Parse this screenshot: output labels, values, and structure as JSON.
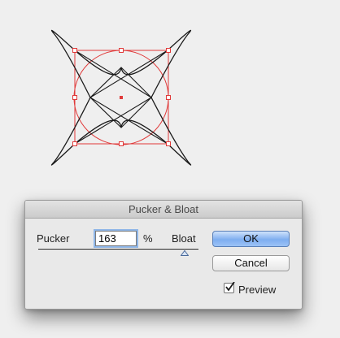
{
  "dialog": {
    "title": "Pucker & Bloat",
    "pucker_label": "Pucker",
    "amount_value": "163",
    "percent_label": "%",
    "bloat_label": "Bloat",
    "ok_label": "OK",
    "cancel_label": "Cancel",
    "preview_label": "Preview",
    "preview_checked": true
  },
  "colors": {
    "selection": "#e03a3a",
    "path": "#1a1a1a",
    "ok_button": "#7eaef0"
  }
}
